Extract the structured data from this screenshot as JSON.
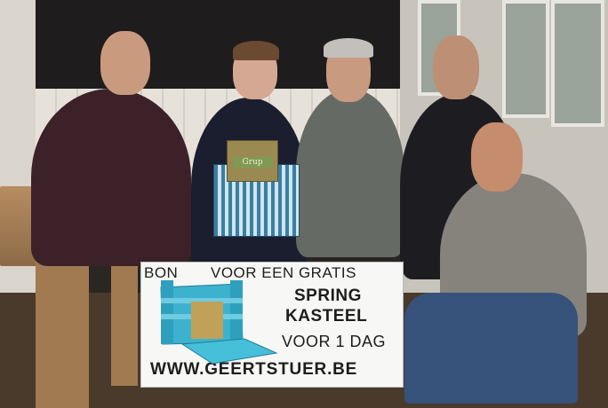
{
  "sign": {
    "line1a": "BON",
    "line1b": "VOOR EEN GRATIS",
    "line2": "SPRING",
    "line3": "KASTEEL",
    "line4": "VOOR 1 DAG",
    "line5": "WWW.GEERTSTUER.BE"
  },
  "gift_box": {
    "label": "Grup"
  },
  "colors": {
    "wall_dark": "#1f1c1d",
    "wainscot": "#e6e2da",
    "striped_box": "#3a7fa0",
    "sign_background": "#f7f7f5",
    "bouncy_castle": "#3db2cf"
  }
}
